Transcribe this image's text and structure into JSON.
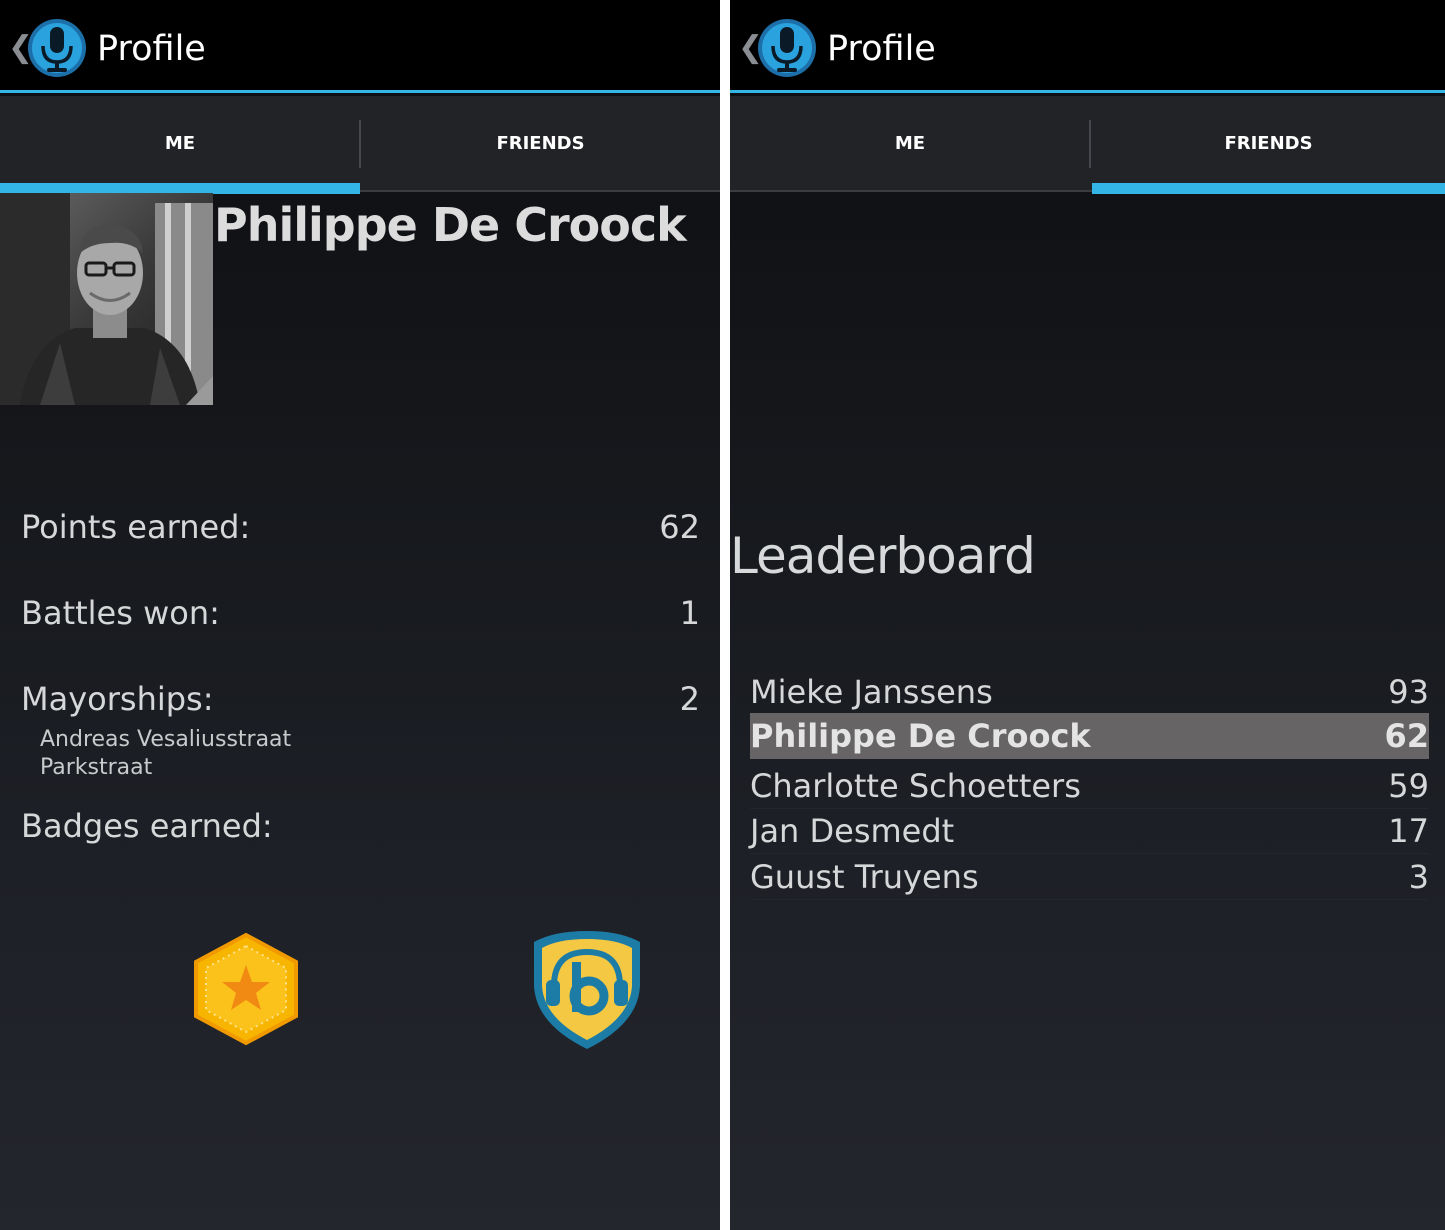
{
  "colors": {
    "accent": "#33b5e5",
    "actionbar": "#000000",
    "tabbar": "#222326",
    "highlight_row": "#666464"
  },
  "left_screen": {
    "actionbar": {
      "title": "Profile",
      "up_icon": "chevron-left-icon",
      "app_icon": "microphone-icon"
    },
    "tabs": [
      {
        "label": "ME",
        "selected": true
      },
      {
        "label": "FRIENDS",
        "selected": false
      }
    ],
    "profile": {
      "name": "Philippe De Croock",
      "points_label": "Points earned:",
      "points_value": "62",
      "battles_label": "Battles won:",
      "battles_value": "1",
      "mayorships_label": "Mayorships:",
      "mayorships_value": "2",
      "mayorships": [
        "Andreas Vesaliusstraat",
        "Parkstraat"
      ],
      "badges_label": "Badges earned:",
      "badges": [
        {
          "icon": "star-hexagon-badge-icon",
          "color": "#f7b500"
        },
        {
          "icon": "b-headphones-shield-badge-icon",
          "color": "#f4c842",
          "secondary_color": "#1d7ca6"
        }
      ]
    }
  },
  "right_screen": {
    "actionbar": {
      "title": "Profile",
      "up_icon": "chevron-left-icon",
      "app_icon": "microphone-icon"
    },
    "tabs": [
      {
        "label": "ME",
        "selected": false
      },
      {
        "label": "FRIENDS",
        "selected": true
      }
    ],
    "leaderboard": {
      "title": "Leaderboard",
      "rows": [
        {
          "name": "Mieke Janssens",
          "score": "93",
          "highlighted": false
        },
        {
          "name": "Philippe De Croock",
          "score": "62",
          "highlighted": true
        },
        {
          "name": "Charlotte Schoetters",
          "score": "59",
          "highlighted": false
        },
        {
          "name": "Jan Desmedt",
          "score": "17",
          "highlighted": false
        },
        {
          "name": "Guust Truyens",
          "score": "3",
          "highlighted": false
        }
      ]
    }
  }
}
